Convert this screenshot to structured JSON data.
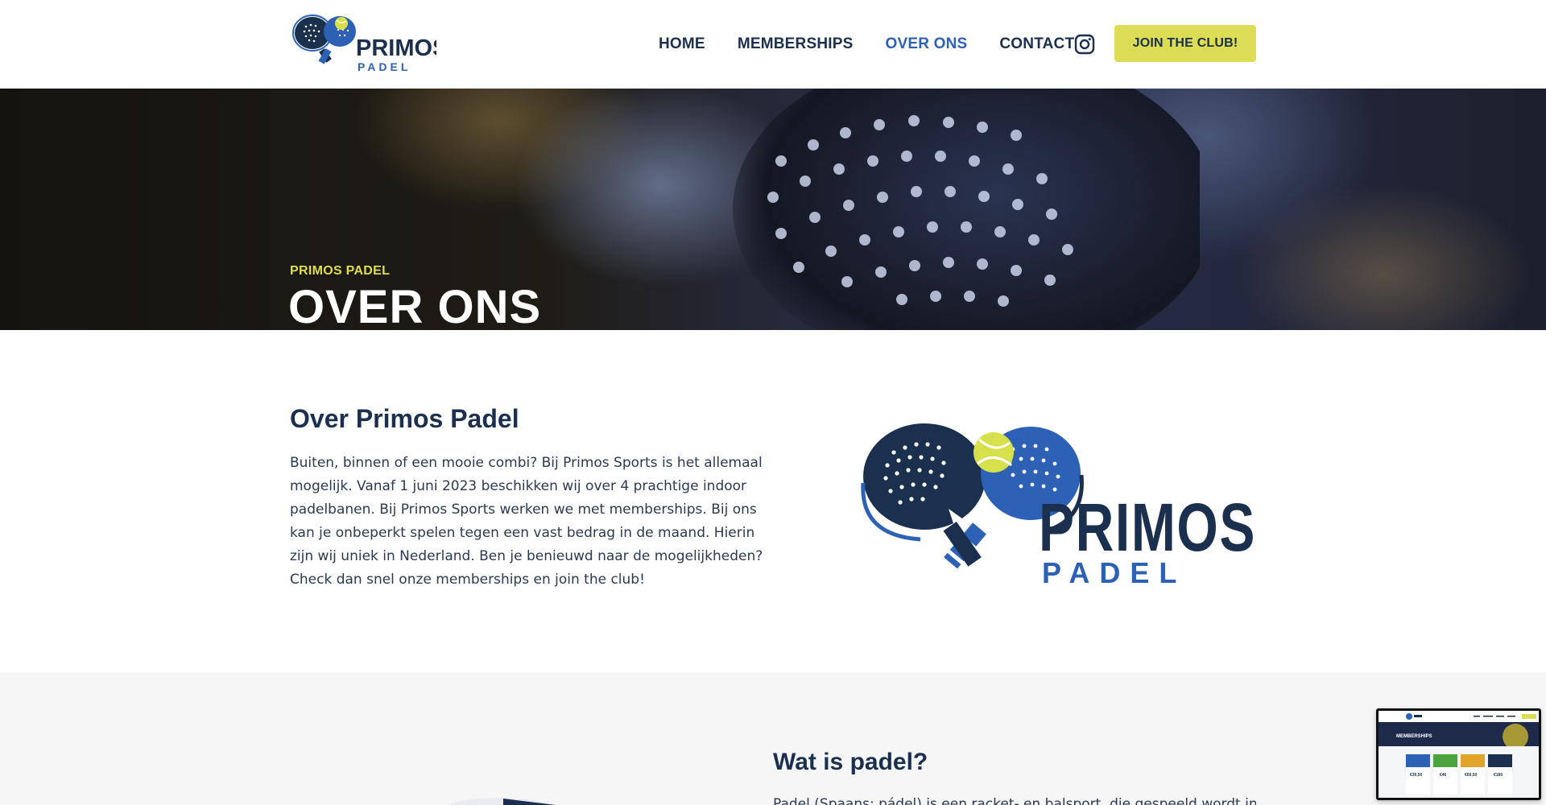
{
  "header": {
    "logo": {
      "name": "PRIMOS",
      "sub": "PADEL",
      "icon": "padel-rackets-logo"
    },
    "nav": [
      {
        "label": "HOME",
        "active": false
      },
      {
        "label": "MEMBERSHIPS",
        "active": false
      },
      {
        "label": "OVER ONS",
        "active": true
      },
      {
        "label": "CONTACT",
        "active": false
      }
    ],
    "instagram_icon": "instagram-icon",
    "join_button": "JOIN THE CLUB!"
  },
  "hero": {
    "kicker": "PRIMOS PADEL",
    "title": "OVER ONS"
  },
  "about": {
    "heading": "Over Primos Padel",
    "body": "Buiten, binnen of een mooie combi? Bij Primos Sports is het allemaal mogelijk. Vanaf 1 juni 2023 beschikken wij over 4 prachtige indoor padelbanen. Bij Primos Sports werken we met memberships. Bij ons kan je onbeperkt spelen tegen een vast bedrag in de maand. Hierin zijn wij uniek in Nederland. Ben je benieuwd naar de mogelijkheden? Check dan snel onze memberships en join the club!"
  },
  "padel": {
    "heading": "Wat is padel?",
    "body": "Padel (Spaans: pádel) is een racket- en balsport, die gespeeld wordt in een"
  },
  "preview": {
    "title": "MEMBERSHIPS",
    "prices": [
      "€39,50",
      "€46",
      "€69,50",
      "€180"
    ]
  },
  "colors": {
    "navy": "#1b2f4e",
    "blue": "#2c61b6",
    "yellow": "#dddd55",
    "hero_kicker": "#dedd4a",
    "section_bg": "#f6f6f6"
  }
}
